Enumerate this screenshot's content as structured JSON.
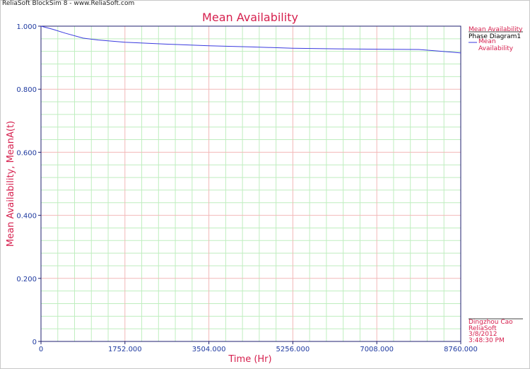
{
  "app": {
    "watermark": "ReliaSoft BlockSim 8 - www.ReliaSoft.com"
  },
  "legend": {
    "title": "Mean Availability",
    "group": "Phase Diagram1",
    "series_label": "Mean Availability"
  },
  "info": {
    "user": "Dingzhou Cao",
    "company": "ReliaSoft",
    "date": "3/8/2012",
    "time": "3:48:30 PM"
  },
  "colors": {
    "title": "#d6204e",
    "axis_text": "#1f3aa0",
    "series": "#3a3adf",
    "grid_major": "#f2b8b8",
    "grid_minor": "#bfeebf"
  },
  "chart_data": {
    "type": "line",
    "title": "Mean Availability",
    "xlabel": "Time (Hr)",
    "ylabel": "Mean Availability, MeanA(t)",
    "xlim": [
      0,
      8760
    ],
    "ylim": [
      0,
      1
    ],
    "x_ticks": [
      "0",
      "1752.000",
      "3504.000",
      "5256.000",
      "7008.000",
      "8760.000"
    ],
    "y_ticks": [
      "0",
      "0.200",
      "0.400",
      "0.600",
      "0.800",
      "1.000"
    ],
    "grid": true,
    "legend_position": "right",
    "series": [
      {
        "name": "Mean Availability",
        "x": [
          0,
          250,
          500,
          876,
          1200,
          1752,
          2600,
          3504,
          4400,
          5256,
          6200,
          7008,
          7884,
          8300,
          8760
        ],
        "y": [
          1.0,
          0.99,
          0.978,
          0.962,
          0.956,
          0.949,
          0.943,
          0.938,
          0.934,
          0.93,
          0.928,
          0.927,
          0.926,
          0.921,
          0.915
        ]
      }
    ]
  }
}
